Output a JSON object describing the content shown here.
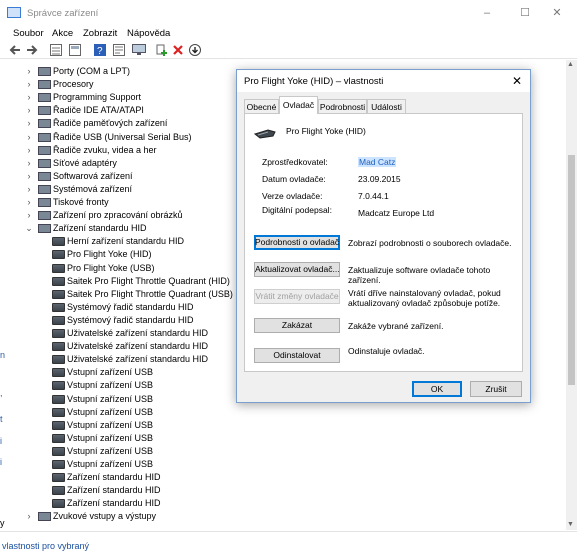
{
  "window": {
    "title": "Správce zařízení",
    "controls": [
      "–",
      "☐",
      "✕"
    ]
  },
  "menu": [
    "Soubor",
    "Akce",
    "Zobrazit",
    "Nápověda"
  ],
  "toolbar_icons": [
    "back-arrow-icon",
    "forward-arrow-icon",
    "properties-grid-icon",
    "list-view-icon",
    "help-icon",
    "details-icon",
    "monitor-icon",
    "add-driver-icon",
    "uninstall-x-icon",
    "download-icon"
  ],
  "tree": [
    {
      "label": "Porty (COM a LPT)",
      "level": 1,
      "expanded": false
    },
    {
      "label": "Procesory",
      "level": 1,
      "expanded": false
    },
    {
      "label": "Programming Support",
      "level": 1,
      "expanded": false
    },
    {
      "label": "Řadiče IDE ATA/ATAPI",
      "level": 1,
      "expanded": false
    },
    {
      "label": "Řadiče paměťových zařízení",
      "level": 1,
      "expanded": false
    },
    {
      "label": "Řadiče USB (Universal Serial Bus)",
      "level": 1,
      "expanded": false
    },
    {
      "label": "Řadiče zvuku, videa a her",
      "level": 1,
      "expanded": false
    },
    {
      "label": "Síťové adaptéry",
      "level": 1,
      "expanded": false
    },
    {
      "label": "Softwarová zařízení",
      "level": 1,
      "expanded": false
    },
    {
      "label": "Systémová zařízení",
      "level": 1,
      "expanded": false
    },
    {
      "label": "Tiskové fronty",
      "level": 1,
      "expanded": false
    },
    {
      "label": "Zařízení pro zpracování obrázků",
      "level": 1,
      "expanded": false
    },
    {
      "label": "Zařízení standardu HID",
      "level": 1,
      "expanded": true
    },
    {
      "label": "Herní zařízení standardu HID",
      "level": 2
    },
    {
      "label": "Pro Flight Yoke (HID)",
      "level": 2
    },
    {
      "label": "Pro Flight Yoke (USB)",
      "level": 2
    },
    {
      "label": "Saitek Pro Flight Throttle Quadrant (HID)",
      "level": 2
    },
    {
      "label": "Saitek Pro Flight Throttle Quadrant (USB)",
      "level": 2
    },
    {
      "label": "Systémový řadič standardu HID",
      "level": 2
    },
    {
      "label": "Systémový řadič standardu HID",
      "level": 2
    },
    {
      "label": "Uživatelské zařízení standardu HID",
      "level": 2
    },
    {
      "label": "Uživatelské zařízení standardu HID",
      "level": 2
    },
    {
      "label": "Uživatelské zařízení standardu HID",
      "level": 2
    },
    {
      "label": "Vstupní zařízení USB",
      "level": 2
    },
    {
      "label": "Vstupní zařízení USB",
      "level": 2
    },
    {
      "label": "Vstupní zařízení USB",
      "level": 2
    },
    {
      "label": "Vstupní zařízení USB",
      "level": 2
    },
    {
      "label": "Vstupní zařízení USB",
      "level": 2
    },
    {
      "label": "Vstupní zařízení USB",
      "level": 2
    },
    {
      "label": "Vstupní zařízení USB",
      "level": 2
    },
    {
      "label": "Vstupní zařízení USB",
      "level": 2
    },
    {
      "label": "Zařízení standardu HID",
      "level": 2
    },
    {
      "label": "Zařízení standardu HID",
      "level": 2
    },
    {
      "label": "Zařízení standardu HID",
      "level": 2
    },
    {
      "label": "Zvukové vstupy a výstupy",
      "level": 1,
      "expanded": false
    }
  ],
  "statusbar": {
    "text": "vlastnosti pro vybraný"
  },
  "dialog": {
    "title": "Pro Flight Yoke (HID) – vlastnosti",
    "close": "✕",
    "tabs": [
      "Obecné",
      "Ovladač",
      "Podrobnosti",
      "Události"
    ],
    "active_tab": "Ovladač",
    "device_name": "Pro Flight Yoke (HID)",
    "props": [
      {
        "label": "Zprostředkovatel:",
        "value": "Mad Catz"
      },
      {
        "label": "Datum ovladače:",
        "value": "23.09.2015"
      },
      {
        "label": "Verze ovladače:",
        "value": "7.0.44.1"
      },
      {
        "label": "Digitální podepsal:",
        "value": "Madcatz Europe Ltd"
      }
    ],
    "actions": [
      {
        "button": "Podrobnosti o ovladači",
        "desc": "Zobrazí podrobnosti o souborech ovladače.",
        "state": "focus"
      },
      {
        "button": "Aktualizovat ovladač...",
        "desc": "Zaktualizuje software ovladače tohoto zařízení.",
        "state": "normal"
      },
      {
        "button": "Vrátit změny ovladače",
        "desc": "Vrátí dříve nainstalovaný ovladač, pokud aktualizovaný ovladač způsobuje potíže.",
        "state": "disabled"
      },
      {
        "button": "Zakázat",
        "desc": "Zakáže vybrané zařízení.",
        "state": "normal"
      },
      {
        "button": "Odinstalovat",
        "desc": "Odinstaluje ovladač.",
        "state": "normal"
      }
    ],
    "ok_label": "OK",
    "cancel_label": "Zrušit"
  }
}
